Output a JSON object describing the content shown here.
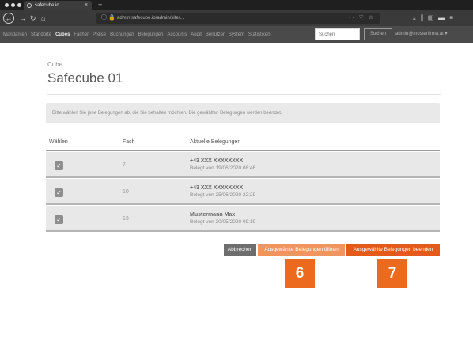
{
  "browser": {
    "tab_title": "safecube.io",
    "tab_close": "×",
    "new_tab": "+",
    "url": "admin.safecube.io/admin/site/...",
    "url_actions": "··· ♡ ☆",
    "lock_icon": "ⓘ 🔒"
  },
  "nav": {
    "items": [
      {
        "label": "Mandanten",
        "active": false
      },
      {
        "label": "Standorte",
        "active": false
      },
      {
        "label": "Cubes",
        "active": true
      },
      {
        "label": "Fächer",
        "active": false
      },
      {
        "label": "Preise",
        "active": false
      },
      {
        "label": "Buchungen",
        "active": false
      },
      {
        "label": "Belegungen",
        "active": false
      },
      {
        "label": "Accounts",
        "active": false
      },
      {
        "label": "Audit",
        "active": false
      },
      {
        "label": "Benutzer",
        "active": false
      },
      {
        "label": "System",
        "active": false
      },
      {
        "label": "Statistiken",
        "active": false
      }
    ],
    "search_placeholder": "Suchen",
    "search_button": "Suchen",
    "user": "admin@musterfirma.at ▾"
  },
  "page": {
    "breadcrumb": "Cube",
    "title": "Safecube 01",
    "info": "Bitte wählen Sie jene Belegungen ab, die Sie behalten möchten. Die gewählten Belegungen werden beendet."
  },
  "table": {
    "headers": {
      "select": "Wählen",
      "fach": "Fach",
      "occupancies": "Aktuelle Belegungen"
    },
    "rows": [
      {
        "checked": true,
        "fach": "7",
        "name": "+43 XXX XXXXXXXX",
        "date": "Belegt von 19/06/2020 08:46"
      },
      {
        "checked": true,
        "fach": "10",
        "name": "+43 XXX XXXXXXXX",
        "date": "Belegt von 25/06/2020 22:29"
      },
      {
        "checked": true,
        "fach": "13",
        "name": "Mustermann Max",
        "date": "Belegt von 20/05/2020 09:19"
      }
    ]
  },
  "actions": {
    "cancel": "Abbrechen",
    "open": "Ausgewählte Belegungen öffnen",
    "end": "Ausgewählte Belegungen beenden"
  },
  "markers": {
    "m6": "6",
    "m7": "7"
  },
  "colors": {
    "accent": "#e45a1a",
    "accent_light": "#f09560",
    "marker": "#ec6a1e"
  }
}
